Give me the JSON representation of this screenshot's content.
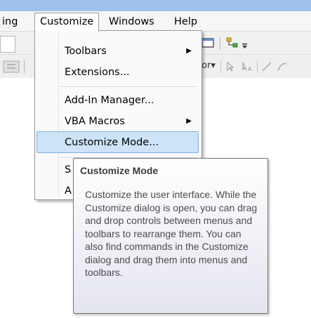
{
  "menubar": {
    "items": [
      {
        "label": "ing"
      },
      {
        "label": "Customize"
      },
      {
        "label": "Windows"
      },
      {
        "label": "Help"
      }
    ]
  },
  "toolbar": {
    "tool_label": "tor",
    "dropdown_arrow": "▾"
  },
  "dropdown": {
    "items": [
      {
        "label": "Toolbars",
        "submenu": true
      },
      {
        "label": "Extensions...",
        "submenu": false
      },
      {
        "label": "Add-In Manager...",
        "submenu": false
      },
      {
        "label": "VBA Macros",
        "submenu": true
      },
      {
        "label": "Customize Mode...",
        "submenu": false,
        "highlighted": true
      },
      {
        "label": "S",
        "submenu": false
      },
      {
        "label": "A",
        "submenu": false
      }
    ],
    "submenu_arrow": "▶"
  },
  "tooltip": {
    "title": "Customize Mode",
    "body": "Customize the user interface. While the Customize dialog is open, you can drag and drop controls between menus and toolbars to rearrange them. You can also find commands in the Customize dialog and drag them into menus and toolbars."
  },
  "colors": {
    "highlight": "#cde3f8",
    "highlight_border": "#7fb0e0",
    "titlebar": "#9ec2ea"
  }
}
